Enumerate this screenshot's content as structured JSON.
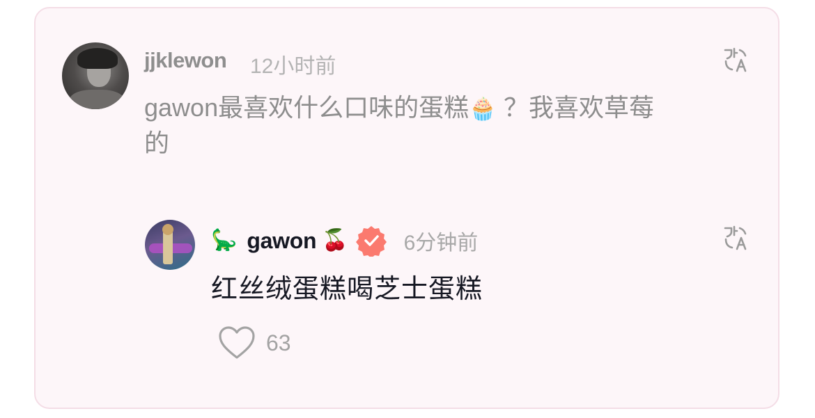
{
  "comment": {
    "username": "jjklewon",
    "time": "12小时前",
    "text_part1": "gawon最喜欢什么口味的蛋糕",
    "text_emoji": "🧁",
    "text_part2": " ？我喜欢草莓的",
    "avatar_icon": "user-avatar-photo",
    "translate_icon": "translate-icon"
  },
  "reply": {
    "prefix_emoji": "🦕",
    "username": "gawon",
    "suffix_emoji": "🍒",
    "verified_badge_icon": "verified-badge-icon",
    "verified_color": "#fb7a6f",
    "time": "6分钟前",
    "text": "红丝绒蛋糕喝芝士蛋糕",
    "avatar_icon": "user-avatar-photo",
    "translate_icon": "translate-icon",
    "like_icon": "heart-outline-icon",
    "like_count": "63"
  },
  "colors": {
    "card_background": "#fdf6f9",
    "card_border": "#f4dde6",
    "muted_text": "#8d8d8d",
    "primary_text": "#161823"
  }
}
